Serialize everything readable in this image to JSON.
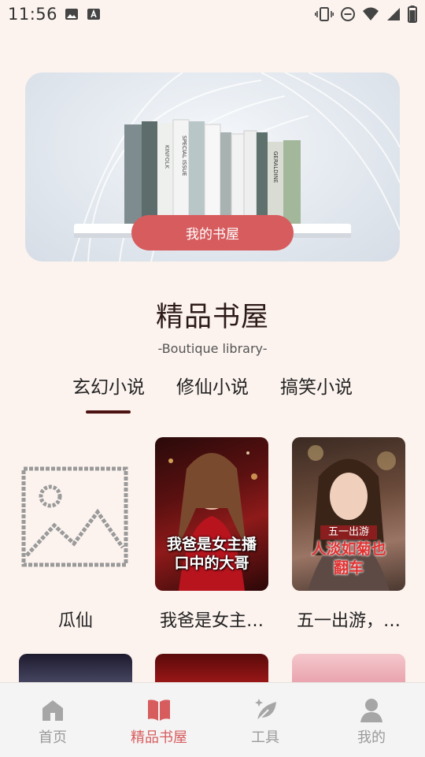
{
  "status_bar": {
    "time": "11:56"
  },
  "banner": {
    "button_label": "我的书屋"
  },
  "header": {
    "title": "精品书屋",
    "subtitle": "-Boutique library-"
  },
  "tabs": [
    {
      "label": "玄幻小说",
      "active": true
    },
    {
      "label": "修仙小说",
      "active": false
    },
    {
      "label": "搞笑小说",
      "active": false
    }
  ],
  "books_row1": [
    {
      "title": "瓜仙",
      "cover": "placeholder"
    },
    {
      "title": "我爸是女主…",
      "cover": "我爸是女主播口中的大哥"
    },
    {
      "title": "五一出游，…",
      "cover": "五一出游 人淡如菊也翻车"
    }
  ],
  "cover_texts": {
    "book2_line1": "我爸是女主播",
    "book2_line2": "口中的大哥",
    "book3_tag": "五一出游",
    "book3_line1": "人淡如菊也",
    "book3_line2": "翻车",
    "book_spine_text_1": "SPECIAL ISSUE",
    "book_spine_text_2": "KINFOLK",
    "book_spine_text_3": "GERALDINE"
  },
  "bottom_nav": [
    {
      "label": "首页",
      "icon": "home-icon",
      "active": false
    },
    {
      "label": "精品书屋",
      "icon": "book-open-icon",
      "active": true
    },
    {
      "label": "工具",
      "icon": "feather-tool-icon",
      "active": false
    },
    {
      "label": "我的",
      "icon": "user-icon",
      "active": false
    }
  ],
  "colors": {
    "accent": "#d75c5e",
    "background": "#fcf3ee",
    "tab_indicator": "#4b1212"
  }
}
